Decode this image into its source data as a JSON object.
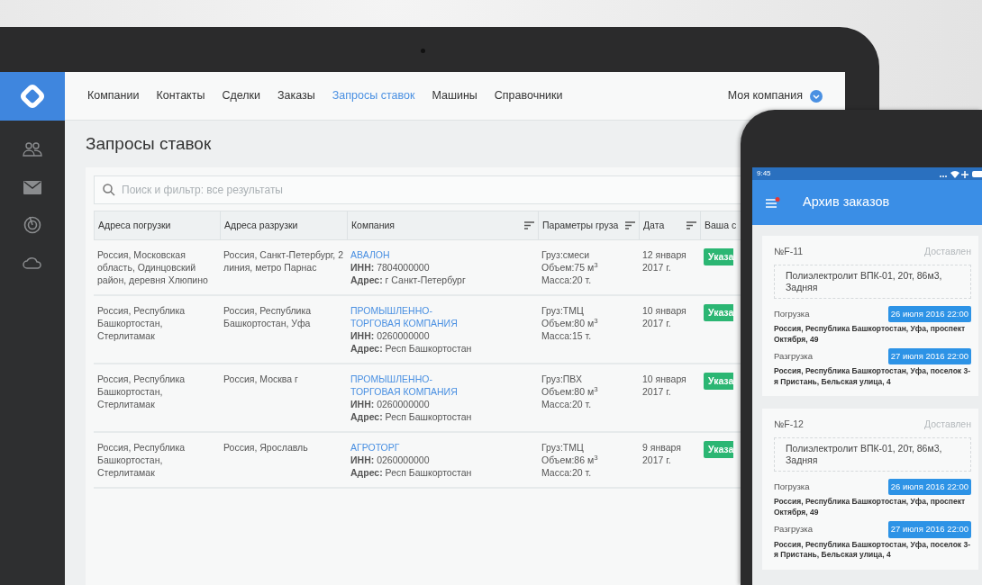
{
  "desktop": {
    "nav": [
      {
        "label": "Компании",
        "selected": false
      },
      {
        "label": "Контакты",
        "selected": false
      },
      {
        "label": "Сделки",
        "selected": false
      },
      {
        "label": "Заказы",
        "selected": false
      },
      {
        "label": "Запросы ставок",
        "selected": true
      },
      {
        "label": "Машины",
        "selected": false
      },
      {
        "label": "Справочники",
        "selected": false
      }
    ],
    "account": "Моя компания",
    "page_title": "Запросы ставок",
    "search": {
      "placeholder": "Поиск и фильтр: все результаты"
    },
    "table": {
      "columns": [
        {
          "label": "Адреса погрузки",
          "sortable": false
        },
        {
          "label": "Адреса разрузки",
          "sortable": false
        },
        {
          "label": "Компания",
          "sortable": true
        },
        {
          "label": "Параметры груза",
          "sortable": true
        },
        {
          "label": "Дата",
          "sortable": true
        },
        {
          "label": "Ваша с",
          "sortable": false
        }
      ],
      "rows": [
        {
          "loading": "Россия, Московская область, Одинцовский район, деревня Хлюпино",
          "unloading": "Россия, Санкт-Петербург, 2 линия, метро Парнас",
          "company": "АВАЛОН",
          "inn": "**ИНН:** 7804000000",
          "address": "**Адрес:** г Санкт-Петербург",
          "cargo": [
            "Груз:смеси",
            "Объем:75 м$^{3}$",
            "Масса:20 т."
          ],
          "date": "12 января 2017 г.",
          "action": "Указа"
        },
        {
          "loading": "Россия, Республика Башкортостан, Стерлитамак",
          "unloading": "Россия, Республика Башкортостан, Уфа",
          "company": "ПРОМЫШЛЕННО-ТОРГОВАЯ КОМПАНИЯ",
          "inn": "**ИНН:** 0260000000",
          "address": "**Адрес:** Респ Башкортостан",
          "cargo": [
            "Груз:ТМЦ",
            "Объем:80 м$^{3}$",
            "Масса:15 т."
          ],
          "date": "10 января 2017 г.",
          "action": "Указа"
        },
        {
          "loading": "Россия, Республика Башкортостан, Стерлитамак",
          "unloading": "Россия, Москва г",
          "company": "ПРОМЫШЛЕННО-ТОРГОВАЯ КОМПАНИЯ",
          "inn": "**ИНН:** 0260000000",
          "address": "**Адрес:** Респ Башкортостан",
          "cargo": [
            "Груз:ПВХ",
            "Объем:80 м$^{3}$",
            "Масса:20 т."
          ],
          "date": "10 января 2017 г.",
          "action": "Указа"
        },
        {
          "loading": "Россия, Республика Башкортостан, Стерлитамак",
          "unloading": "Россия, Ярославль",
          "company": "АГРОТОРГ",
          "inn": "**ИНН:** 0260000000",
          "address": "**Адрес:** Респ Башкортостан",
          "cargo": [
            "Груз:ТМЦ",
            "Объем:86 м$^{3}$",
            "Масса:20 т."
          ],
          "date": "9 января 2017 г.",
          "action": "Указа"
        }
      ]
    }
  },
  "phone": {
    "time": "9:45",
    "title": "Архив заказов",
    "notification": true,
    "orders": [
      {
        "number": "№F-11",
        "status": "Доставлен",
        "cargo": "Полиэлектролит ВПК-01, 20т, 86м3, Задняя",
        "stops": [
          {
            "label": "Погрузка",
            "date": "26 июля 2016 22:00",
            "address": "Россия, Республика Башкортостан, Уфа, проспект Октября, 49"
          },
          {
            "label": "Разгрузка",
            "date": "27 июля 2016 22:00",
            "address": "Россия, Республика Башкортостан, Уфа, поселок 3-я Пристань, Бельская улица, 4"
          }
        ]
      },
      {
        "number": "№F-12",
        "status": "Доставлен",
        "cargo": "Полиэлектролит ВПК-01, 20т, 86м3, Задняя",
        "stops": [
          {
            "label": "Погрузка",
            "date": "26 июля 2016 22:00",
            "address": "Россия, Республика Башкортостан, Уфа, проспект Октября, 49"
          },
          {
            "label": "Разгрузка",
            "date": "27 июля 2016 22:00",
            "address": "Россия, Республика Башкортостан, Уфа, поселок 3-я Пристань, Бельская улица, 4"
          }
        ]
      }
    ]
  }
}
